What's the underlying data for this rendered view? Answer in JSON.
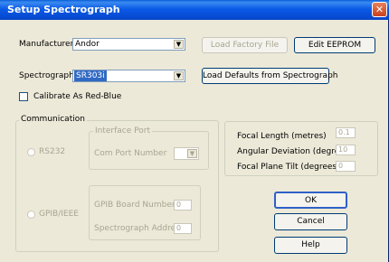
{
  "window": {
    "title": "Setup Spectrograph",
    "close_glyph": "✕"
  },
  "manufacturer": {
    "label": "Manufacturer",
    "value": "Andor"
  },
  "spectrograph": {
    "label": "Spectrograph",
    "value": "SR303i"
  },
  "buttons": {
    "load_factory": "Load Factory File",
    "edit_eeprom": "Edit EEPROM",
    "load_defaults": "Load Defaults from Spectrograph",
    "ok": "OK",
    "cancel": "Cancel",
    "help": "Help"
  },
  "calibrate": {
    "label": "Calibrate As Red-Blue",
    "checked": false
  },
  "communication": {
    "legend": "Communication",
    "rs232": "RS232",
    "interface_port": "Interface Port",
    "com_port_number": "Com Port Number",
    "gpib": "GPIB/IEEE",
    "gpib_board_number": {
      "label": "GPIB Board Number",
      "value": "0"
    },
    "spectrograph_address": {
      "label": "Spectrograph Address",
      "value": "0"
    }
  },
  "params": {
    "focal_length": {
      "label": "Focal Length (metres)",
      "value": "0.1"
    },
    "angular_deviation": {
      "label": "Angular Deviation (degrees)",
      "value": "10"
    },
    "focal_plane_tilt": {
      "label": "Focal Plane Tilt (degrees)",
      "value": "0"
    }
  }
}
